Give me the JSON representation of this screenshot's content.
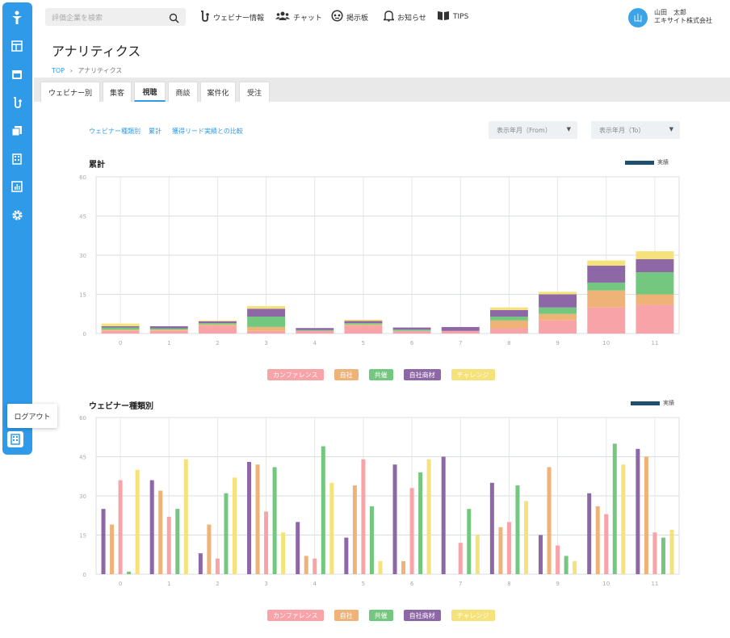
{
  "header": {
    "search_placeholder": "評価企業を検索",
    "nav": [
      {
        "label": "ウェビナー情報",
        "icon": "webinar-icon"
      },
      {
        "label": "チャット",
        "icon": "users-icon"
      },
      {
        "label": "掲示板",
        "icon": "board-icon"
      },
      {
        "label": "お知らせ",
        "icon": "bell-icon"
      },
      {
        "label": "TIPS",
        "icon": "book-icon"
      }
    ],
    "user": {
      "avatar": "山",
      "name": "山田　太郎",
      "company": "エキサイト株式会社"
    }
  },
  "sidebar": {
    "icons": [
      "logo-icon",
      "layout-icon",
      "calendar-icon",
      "webinar-icon",
      "copy-icon",
      "building-icon",
      "chart-icon",
      "gear-icon"
    ],
    "logout_label": "ログアウト"
  },
  "page": {
    "title": "アナリティクス",
    "breadcrumb_top": "TOP",
    "breadcrumb_current": "アナリティクス"
  },
  "tabs": [
    "ウェビナー別",
    "集客",
    "視聴",
    "商談",
    "案件化",
    "受注"
  ],
  "active_tab": "視聴",
  "filters": {
    "links": [
      "ウェビナー種類別",
      "累計",
      "獲得リード実績との比較"
    ],
    "from_label": "表示年月（From）",
    "to_label": "表示年月（To）"
  },
  "colors": {
    "conference": "#f7a3a8",
    "seminar": "#efb277",
    "cohost": "#74c77e",
    "own": "#8d67a6",
    "challenge": "#f5e27a",
    "accent": "#2f9ae8",
    "jisseki": "#1f4e6e"
  },
  "legend": {
    "jisseki": "実績",
    "categories": [
      "カンファレンス",
      "自社",
      "共催",
      "自社商材",
      "チャレンジ"
    ]
  },
  "chart_data": [
    {
      "type": "bar",
      "title": "累計",
      "stacked": true,
      "categories": [
        "0",
        "1",
        "2",
        "3",
        "4",
        "5",
        "6",
        "7",
        "8",
        "9",
        "10",
        "11"
      ],
      "yticks": [
        "0",
        "15",
        "30",
        "45",
        "60"
      ],
      "ylim": [
        0,
        60
      ],
      "grid": true,
      "series": [
        {
          "name": "カンファレンス",
          "values": [
            1,
            1,
            3,
            1,
            1,
            3,
            1,
            1,
            2,
            5,
            10,
            11
          ]
        },
        {
          "name": "自社",
          "values": [
            0.5,
            0.5,
            0.5,
            1.5,
            0,
            0.5,
            0,
            0,
            3,
            2.5,
            6.5,
            4
          ]
        },
        {
          "name": "共催",
          "values": [
            0.8,
            0.5,
            0.5,
            4,
            0.3,
            0.5,
            0.5,
            0,
            1.5,
            2.5,
            3,
            8.5
          ]
        },
        {
          "name": "自社商材",
          "values": [
            0.5,
            0.8,
            0.7,
            3,
            0.8,
            0.8,
            0.8,
            1.5,
            2.5,
            5,
            6.5,
            5
          ]
        },
        {
          "name": "チャレンジ",
          "values": [
            1,
            0,
            0.3,
            1,
            0,
            0.5,
            0,
            0,
            1,
            1,
            2,
            3
          ]
        }
      ],
      "legend": "top-right"
    },
    {
      "type": "bar",
      "title": "ウェビナー種類別",
      "stacked": false,
      "categories": [
        "0",
        "1",
        "2",
        "3",
        "4",
        "5",
        "6",
        "7",
        "8",
        "9",
        "10",
        "11"
      ],
      "yticks": [
        "0",
        "15",
        "30",
        "45",
        "60"
      ],
      "ylim": [
        0,
        60
      ],
      "grid": true,
      "series": [
        {
          "name": "自社商材",
          "values": [
            25,
            36,
            8,
            43,
            20,
            14,
            42,
            45,
            35,
            15,
            31,
            48
          ]
        },
        {
          "name": "自社",
          "values": [
            19,
            32,
            19,
            42,
            7,
            34,
            5,
            0,
            18,
            41,
            26,
            45
          ]
        },
        {
          "name": "カンファレンス",
          "values": [
            36,
            22,
            6,
            24,
            6,
            44,
            33,
            12,
            20,
            11,
            23,
            16
          ]
        },
        {
          "name": "共催",
          "values": [
            1,
            25,
            31,
            41,
            49,
            26,
            39,
            25,
            34,
            7,
            50,
            14
          ]
        },
        {
          "name": "チャレンジ",
          "values": [
            40,
            44,
            37,
            16,
            35,
            5,
            44,
            15,
            28,
            5,
            42,
            17
          ]
        }
      ],
      "legend": "top-right"
    }
  ]
}
